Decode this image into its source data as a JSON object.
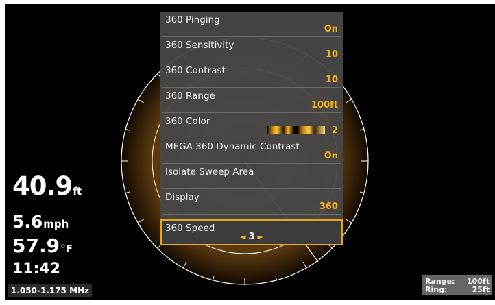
{
  "menu": {
    "items": [
      {
        "label": "360 Pinging",
        "value": "On"
      },
      {
        "label": "360 Sensitivity",
        "value": "10"
      },
      {
        "label": "360 Contrast",
        "value": "10"
      },
      {
        "label": "360 Range",
        "value": "100ft"
      },
      {
        "label": "360 Color",
        "value": "2"
      },
      {
        "label": "MEGA 360 Dynamic Contrast",
        "value": "On"
      },
      {
        "label": "Isolate Sweep Area",
        "value": ""
      },
      {
        "label": "Display",
        "value": "360"
      },
      {
        "label": "360 Speed",
        "value": "3"
      }
    ],
    "stepper_left": "◄",
    "stepper_right": "►"
  },
  "readouts": {
    "depth_value": "40.9",
    "depth_unit": "ft",
    "speed_value": "5.6",
    "speed_unit": "mph",
    "temp_value": "57.9",
    "temp_unit": "°F",
    "time": "11:42",
    "frequency": "1.050-1.175 MHz"
  },
  "range_box": {
    "range_label": "Range:",
    "range_value": "100ft",
    "ring_label": "Ring:",
    "ring_value": "25ft"
  },
  "colors": {
    "accent": "#f6b319",
    "menu_bg": "#484848",
    "screen_bg": "#000000"
  }
}
